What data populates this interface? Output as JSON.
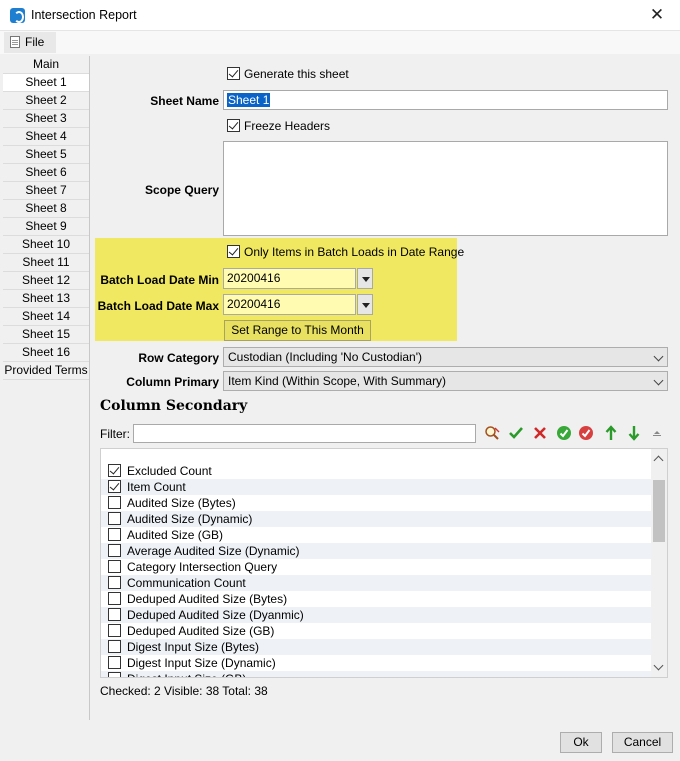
{
  "window": {
    "title": "Intersection Report",
    "close_glyph": "✕"
  },
  "menu": {
    "file_label": "File"
  },
  "sidebar": {
    "items": [
      "Main",
      "Sheet 1",
      "Sheet 2",
      "Sheet 3",
      "Sheet 4",
      "Sheet 5",
      "Sheet 6",
      "Sheet 7",
      "Sheet 8",
      "Sheet 9",
      "Sheet 10",
      "Sheet 11",
      "Sheet 12",
      "Sheet 13",
      "Sheet 14",
      "Sheet 15",
      "Sheet 16",
      "Provided Terms"
    ],
    "selected": "Sheet 1"
  },
  "form": {
    "generate_label": "Generate this sheet",
    "generate_checked": true,
    "sheet_name_label": "Sheet Name",
    "sheet_name_value": "Sheet 1",
    "freeze_label": "Freeze Headers",
    "freeze_checked": true,
    "scope_query_label": "Scope Query",
    "scope_query_value": "",
    "only_items_label": "Only Items in Batch Loads in Date Range",
    "only_items_checked": true,
    "date_min_label": "Batch Load Date Min",
    "date_min_value": "20200416",
    "date_max_label": "Batch Load Date Max",
    "date_max_value": "20200416",
    "set_range_label": "Set Range to This Month",
    "row_category_label": "Row Category",
    "row_category_value": "Custodian (Including 'No Custodian')",
    "column_primary_label": "Column Primary",
    "column_primary_value": "Item Kind (Within Scope, With Summary)"
  },
  "column_secondary": {
    "title": "Column Secondary",
    "filter_label": "Filter:",
    "filter_value": "",
    "toolbar_icons": [
      "search-clear-icon",
      "check-icon",
      "cross-icon",
      "check-all-icon",
      "uncheck-all-icon",
      "move-up-icon",
      "move-down-icon",
      "collapse-icon"
    ],
    "items": [
      {
        "label": "Excluded Count",
        "checked": true
      },
      {
        "label": "Item Count",
        "checked": true
      },
      {
        "label": "Audited Size (Bytes)",
        "checked": false
      },
      {
        "label": "Audited Size (Dynamic)",
        "checked": false
      },
      {
        "label": "Audited Size (GB)",
        "checked": false
      },
      {
        "label": "Average Audited Size (Dynamic)",
        "checked": false
      },
      {
        "label": "Category Intersection Query",
        "checked": false
      },
      {
        "label": "Communication Count",
        "checked": false
      },
      {
        "label": "Deduped Audited Size (Bytes)",
        "checked": false
      },
      {
        "label": "Deduped Audited Size (Dyanmic)",
        "checked": false
      },
      {
        "label": "Deduped Audited Size (GB)",
        "checked": false
      },
      {
        "label": "Digest Input Size (Bytes)",
        "checked": false
      },
      {
        "label": "Digest Input Size (Dynamic)",
        "checked": false
      },
      {
        "label": "Digest Input Size (GB)",
        "checked": false
      }
    ],
    "status": "Checked: 2 Visible: 38 Total: 38"
  },
  "buttons": {
    "ok_label": "Ok",
    "cancel_label": "Cancel"
  },
  "colors": {
    "highlight": "#f0e860",
    "selection": "#0a64c8",
    "alt_row": "#eef2f7"
  }
}
